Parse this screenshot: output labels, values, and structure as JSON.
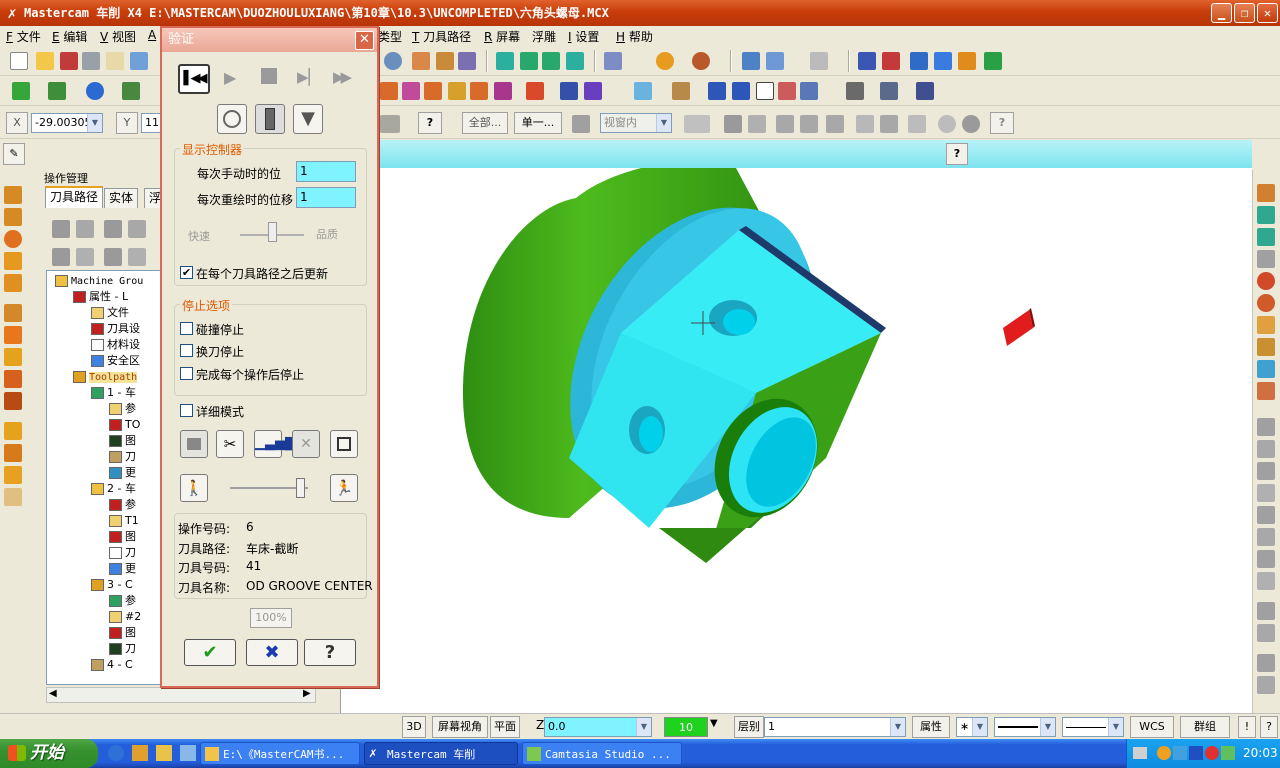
{
  "window": {
    "title": "Mastercam 车削  X4  E:\\MASTERCAM\\DUOZHOULUXIANG\\第10章\\10.3\\UNCOMPLETED\\六角头螺母.MCX",
    "min": "▁",
    "restore": "❐",
    "close": "✕"
  },
  "menu": [
    {
      "key": "F",
      "label": "文件"
    },
    {
      "key": "E",
      "label": "编辑"
    },
    {
      "key": "V",
      "label": "视图"
    },
    {
      "key": "A",
      "label": ""
    },
    {
      "key": "",
      "label": "类型"
    },
    {
      "key": "T",
      "label": "刀具路径"
    },
    {
      "key": "R",
      "label": "屏幕"
    },
    {
      "key": "",
      "label": "浮雕"
    },
    {
      "key": "I",
      "label": "设置"
    },
    {
      "key": "H",
      "label": "帮助"
    }
  ],
  "coord": {
    "x_label": "X",
    "x_value": "-29.00305",
    "y_label": "Y",
    "y_value": "11."
  },
  "toolbar3": {
    "all": "全部...",
    "single": "单一...",
    "view": "视窗内"
  },
  "ops": {
    "header": "操作管理",
    "tabs": [
      "刀具路径",
      "实体",
      "浮"
    ],
    "tree": [
      {
        "t": "Machine Grou",
        "lvl": 0,
        "mono": true
      },
      {
        "t": "属性 - L",
        "lvl": 1
      },
      {
        "t": "文件",
        "lvl": 2
      },
      {
        "t": "刀具设",
        "lvl": 2
      },
      {
        "t": "材料设",
        "lvl": 2
      },
      {
        "t": "安全区",
        "lvl": 2
      },
      {
        "t": "Toolpath",
        "lvl": 1,
        "mono": true,
        "hl": true
      },
      {
        "t": "1 - 车",
        "lvl": 2
      },
      {
        "t": "参",
        "lvl": 3
      },
      {
        "t": "TO",
        "lvl": 3
      },
      {
        "t": "图",
        "lvl": 3
      },
      {
        "t": "刀",
        "lvl": 3
      },
      {
        "t": "更",
        "lvl": 3
      },
      {
        "t": "2 - 车",
        "lvl": 2
      },
      {
        "t": "参",
        "lvl": 3
      },
      {
        "t": "T1",
        "lvl": 3
      },
      {
        "t": "图",
        "lvl": 3
      },
      {
        "t": "刀",
        "lvl": 3
      },
      {
        "t": "更",
        "lvl": 3
      },
      {
        "t": "3 - C",
        "lvl": 2
      },
      {
        "t": "参",
        "lvl": 3
      },
      {
        "t": "#2",
        "lvl": 3
      },
      {
        "t": "图",
        "lvl": 3
      },
      {
        "t": "刀",
        "lvl": 3
      },
      {
        "t": "4 - C",
        "lvl": 2
      }
    ]
  },
  "dialog": {
    "title": "验证",
    "display_group": "显示控制器",
    "step_label": "每次手动时的位",
    "step_value": "1",
    "redraw_label": "每次重绘时的位移",
    "redraw_value": "1",
    "speed_fast": "快速",
    "speed_quality": "品质",
    "update_label": "在每个刀具路径之后更新",
    "stop_group": "停止选项",
    "stop_collision": "碰撞停止",
    "stop_toolchange": "换刀停止",
    "stop_each": "完成每个操作后停止",
    "verbose": "详细模式",
    "info": [
      {
        "k": "操作号码:",
        "v": "6"
      },
      {
        "k": "刀具路径:",
        "v": "车床-截断"
      },
      {
        "k": "刀具号码:",
        "v": "41"
      },
      {
        "k": "刀具名称:",
        "v": "OD GROOVE CENTER"
      }
    ],
    "progress": "100%",
    "ok": "✔",
    "cancel": "✖",
    "help": "?"
  },
  "status": {
    "b3d": "3D",
    "screen_view": "屏幕视角",
    "plane": "平面",
    "z_label": "Z",
    "z_value": "0.0",
    "color_value": "10",
    "level_label": "层别",
    "level_value": "1",
    "attr": "属性",
    "wcs": "WCS",
    "group": "群组"
  },
  "taskbar": {
    "start": "开始",
    "items": [
      "E:\\《MasterCAM书...",
      "Mastercam 车削",
      "Camtasia Studio ..."
    ],
    "time": "20:03"
  },
  "colors": {
    "accent": "#c93d0a",
    "dialog_border": "#d86a55",
    "field": "#7ff3ff",
    "part_green": "#3aa116",
    "part_cyan": "#2ee6f2"
  }
}
